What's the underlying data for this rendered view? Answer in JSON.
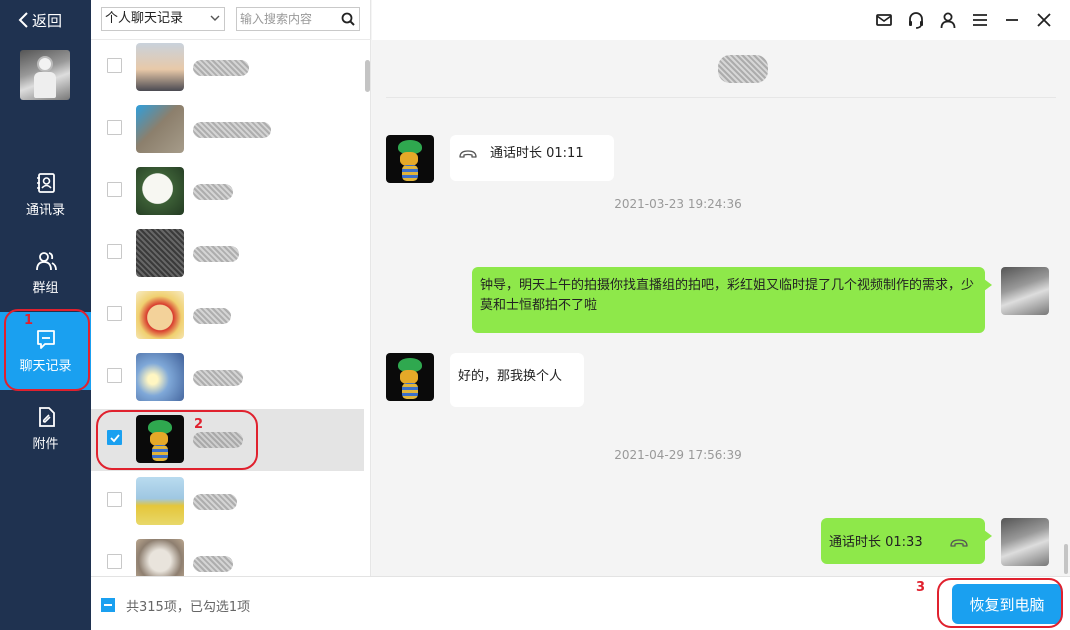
{
  "sidebar": {
    "back_label": "返回",
    "nav": [
      {
        "label": "通讯录",
        "icon": "contacts-icon"
      },
      {
        "label": "群组",
        "icon": "group-icon"
      },
      {
        "label": "聊天记录",
        "icon": "chat-icon"
      },
      {
        "label": "附件",
        "icon": "attachment-icon"
      }
    ],
    "active_index": 2
  },
  "list": {
    "type_select": "个人聊天记录",
    "search_placeholder": "输入搜索内容",
    "selected_row_index": 6
  },
  "bottom": {
    "selection_info": "共315项，已勾选1项",
    "restore_label": "恢复到电脑"
  },
  "chat": {
    "messages": [
      {
        "dir": "in",
        "type": "call",
        "text": "通话时长 01:11"
      },
      {
        "type": "timestamp",
        "text": "2021-03-23 19:24:36"
      },
      {
        "dir": "out",
        "type": "text",
        "text": "钟导，明天上午的拍摄你找直播组的拍吧，彩红姐又临时提了几个视频制作的需求，少莫和士恒都拍不了啦"
      },
      {
        "dir": "in",
        "type": "text",
        "text": "好的，那我换个人"
      },
      {
        "type": "timestamp",
        "text": "2021-04-29 17:56:39"
      },
      {
        "dir": "out",
        "type": "call",
        "text": "通话时长 01:33"
      }
    ]
  },
  "topbar_icons": [
    "mail-icon",
    "headset-icon",
    "user-icon",
    "menu-icon",
    "minimize-icon",
    "close-icon"
  ],
  "annotations": [
    "1",
    "2",
    "3"
  ],
  "colors": {
    "sidebar": "#1f3250",
    "accent": "#1aa0f0",
    "out_bubble": "#8ee84a",
    "annotation": "#e0212e"
  }
}
